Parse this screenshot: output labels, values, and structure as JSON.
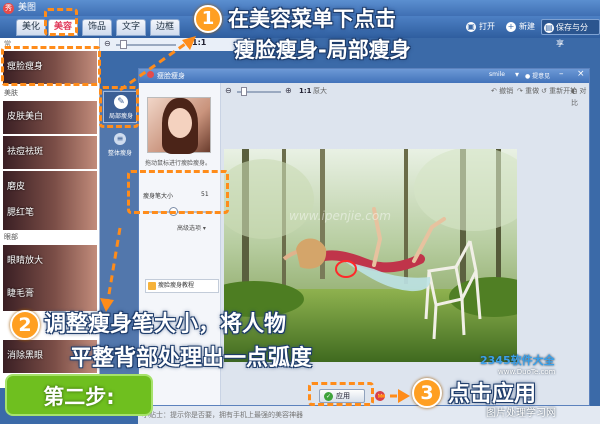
{
  "app": {
    "title": "美图"
  },
  "nav": {
    "tabs": [
      {
        "label": "美化"
      },
      {
        "label": "美容"
      },
      {
        "label": "饰品"
      },
      {
        "label": "文字"
      },
      {
        "label": "边框"
      }
    ],
    "open_label": "打开",
    "new_label": "新建",
    "save_label": "保存与分享"
  },
  "zoom": {
    "ratio": "1:1"
  },
  "left_panel": {
    "head": "常",
    "categories": [
      {
        "label": "瘦脸瘦身"
      },
      {
        "label": "皮肤美白"
      },
      {
        "label": "祛痘祛斑"
      },
      {
        "label": "磨皮"
      },
      {
        "label": "腮红笔"
      },
      {
        "label": "眼睛放大"
      },
      {
        "label": "睫毛膏"
      },
      {
        "label": "消除黑眼"
      }
    ],
    "section_skin": "美肤",
    "section_eye": "眼部"
  },
  "tool_column": {
    "local_slim": "局部瘦身",
    "overall_slim": "整体瘦身"
  },
  "dialog": {
    "title": "瘦脸瘦身",
    "user": "smile",
    "feedback": "提意见",
    "zoom_ratio": "1:1",
    "original_size": "原大",
    "undo": "撤销",
    "redo": "重做",
    "reset": "重新开始",
    "compare": "对比",
    "hint": "拖动鼠标进行瘦脸瘦身。",
    "brush_size_label": "瘦身笔大小",
    "brush_size_value": "51",
    "advanced": "高级选项",
    "tutorial": "瘦脸瘦身教程",
    "apply": "应用",
    "watermark": "www.ipenjie.com"
  },
  "status": {
    "text": "小贴士：提示你是否要，拥有手机上最强的美容神器"
  },
  "annotations": {
    "step1_num": "1",
    "step1_line1": "在美容菜单下点击",
    "step1_line2": "瘦脸瘦身-局部瘦身",
    "step2_num": "2",
    "step2_line1": "调整瘦身笔大小，将人物",
    "step2_line2": "平整背部处理出一点弧度",
    "step3_num": "3",
    "step3_text": "点击应用",
    "step_label": "第二步:",
    "brand": "2345软件大全",
    "brand_url": "www.DuoTe.com",
    "site": "图片处理学习网"
  },
  "colors": {
    "accent_orange": "#ff8c1a",
    "step_green": "#6fbf1f",
    "app_blue": "#3b6aa8"
  }
}
